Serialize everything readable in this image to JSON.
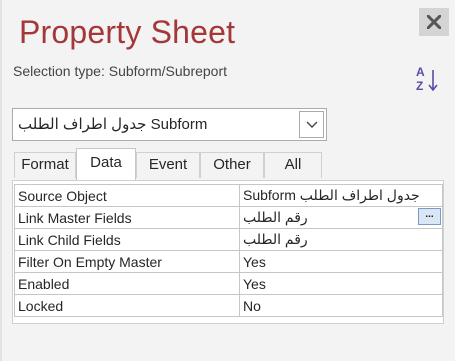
{
  "panel": {
    "title": "Property Sheet",
    "selection_type_label": "Selection type:",
    "selection_type_value": "Subform/Subreport"
  },
  "object_selector": {
    "value": "جدول اطراف الطلب Subform"
  },
  "tabs": [
    {
      "label": "Format",
      "active": false
    },
    {
      "label": "Data",
      "active": true
    },
    {
      "label": "Event",
      "active": false
    },
    {
      "label": "Other",
      "active": false
    },
    {
      "label": "All",
      "active": false
    }
  ],
  "properties": [
    {
      "name": "Source Object",
      "value": "جدول اطراف الطلب Subform",
      "rtl": true
    },
    {
      "name": "Link Master Fields",
      "value": "رقم الطلب",
      "rtl": true,
      "has_builder": true,
      "builder_label": "..."
    },
    {
      "name": "Link Child Fields",
      "value": "رقم الطلب",
      "rtl": true
    },
    {
      "name": "Filter On Empty Master",
      "value": "Yes"
    },
    {
      "name": "Enabled",
      "value": "Yes"
    },
    {
      "name": "Locked",
      "value": "No"
    }
  ],
  "icons": {
    "close": "close-icon",
    "sort": "sort-az-icon",
    "dropdown": "chevron-down-icon"
  },
  "colors": {
    "title": "#a4373a",
    "sort_icon": "#5c4aa8",
    "panel_bg": "#f3f3f3"
  }
}
